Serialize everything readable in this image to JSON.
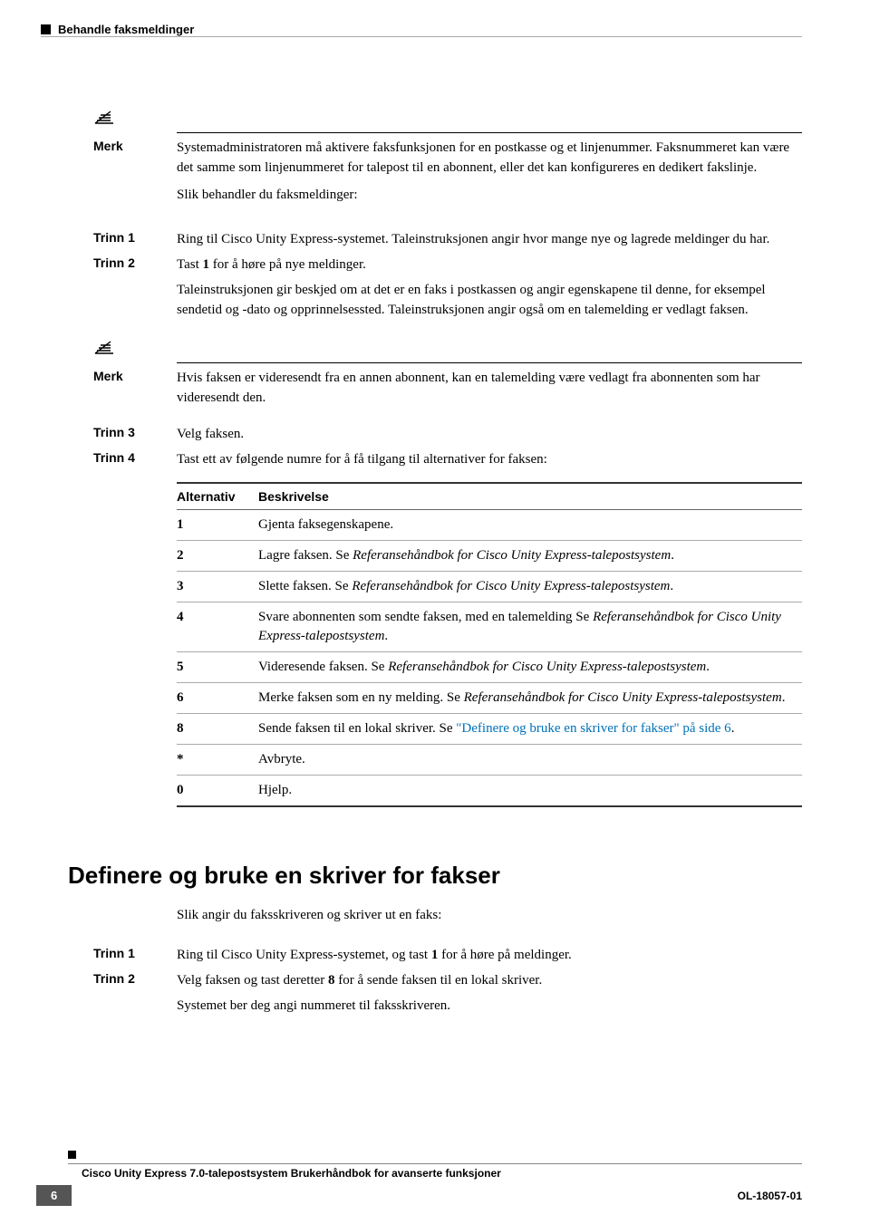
{
  "header": {
    "title": "Behandle faksmeldinger"
  },
  "merk1": {
    "label": "Merk",
    "body": "Systemadministratoren må aktivere faksfunksjonen for en postkasse og et linjenummer. Faksnummeret kan være det samme som linjenummeret for talepost til en abonnent, eller det kan konfigureres en dedikert fakslinje."
  },
  "intro1": "Slik behandler du faksmeldinger:",
  "step1": {
    "label": "Trinn 1",
    "body": "Ring til Cisco Unity Express-systemet. Taleinstruksjonen angir hvor mange nye og lagrede meldinger du har."
  },
  "step2": {
    "label": "Trinn 2",
    "l1": "Tast ",
    "bold1": "1",
    "l1b": " for å høre på nye meldinger.",
    "l2": "Taleinstruksjonen gir beskjed om at det er en faks i postkassen og angir egenskapene til denne, for eksempel sendetid og -dato og opprinnelsessted. Taleinstruksjonen angir også om en talemelding er vedlagt faksen."
  },
  "merk2": {
    "label": "Merk",
    "body": "Hvis faksen er videresendt fra en annen abonnent, kan en talemelding være vedlagt fra abonnenten som har videresendt den."
  },
  "step3": {
    "label": "Trinn 3",
    "body": "Velg faksen."
  },
  "step4": {
    "label": "Trinn 4",
    "body": "Tast ett av følgende numre for å få tilgang til alternativer for faksen:"
  },
  "table": {
    "h1": "Alternativ",
    "h2": "Beskrivelse",
    "rows": [
      {
        "k": "1",
        "v": "Gjenta faksegenskapene."
      },
      {
        "k": "2",
        "v_pre": "Lagre faksen. Se ",
        "v_it": "Referansehåndbok for Cisco Unity Express-talepostsystem",
        "v_post": "."
      },
      {
        "k": "3",
        "v_pre": "Slette faksen. Se ",
        "v_it": "Referansehåndbok for Cisco Unity Express-talepostsystem",
        "v_post": "."
      },
      {
        "k": "4",
        "v_pre": "Svare abonnenten som sendte faksen, med en talemelding Se ",
        "v_it": "Referansehåndbok for Cisco Unity Express-talepostsystem",
        "v_post": "."
      },
      {
        "k": "5",
        "v_pre": "Videresende faksen. Se ",
        "v_it": "Referansehåndbok for Cisco Unity Express-talepostsystem",
        "v_post": "."
      },
      {
        "k": "6",
        "v_pre": "Merke faksen som en ny melding. Se ",
        "v_it": "Referansehåndbok for Cisco Unity Express-talepostsystem",
        "v_post": "."
      },
      {
        "k": "8",
        "v_pre": "Sende faksen til en lokal skriver. Se ",
        "v_link": "\"Definere og bruke en skriver for fakser\" på side 6",
        "v_post": "."
      },
      {
        "k": "*",
        "v": "Avbryte."
      },
      {
        "k": "0",
        "v": "Hjelp."
      }
    ]
  },
  "section2": {
    "title": "Definere og bruke en skriver for fakser",
    "intro": "Slik angir du faksskriveren og skriver ut en faks:",
    "step1": {
      "label": "Trinn 1",
      "pre": "Ring til Cisco Unity Express-systemet, og tast ",
      "bold": "1",
      "post": " for å høre på meldinger."
    },
    "step2": {
      "label": "Trinn 2",
      "pre": "Velg faksen og tast deretter ",
      "bold": "8",
      "post": " for å sende faksen til en lokal skriver."
    },
    "step2b": "Systemet ber deg angi nummeret til faksskriveren."
  },
  "footer": {
    "title": "Cisco Unity Express 7.0-talepostsystem Brukerhåndbok for avanserte funksjoner",
    "page": "6",
    "docid": "OL-18057-01"
  }
}
